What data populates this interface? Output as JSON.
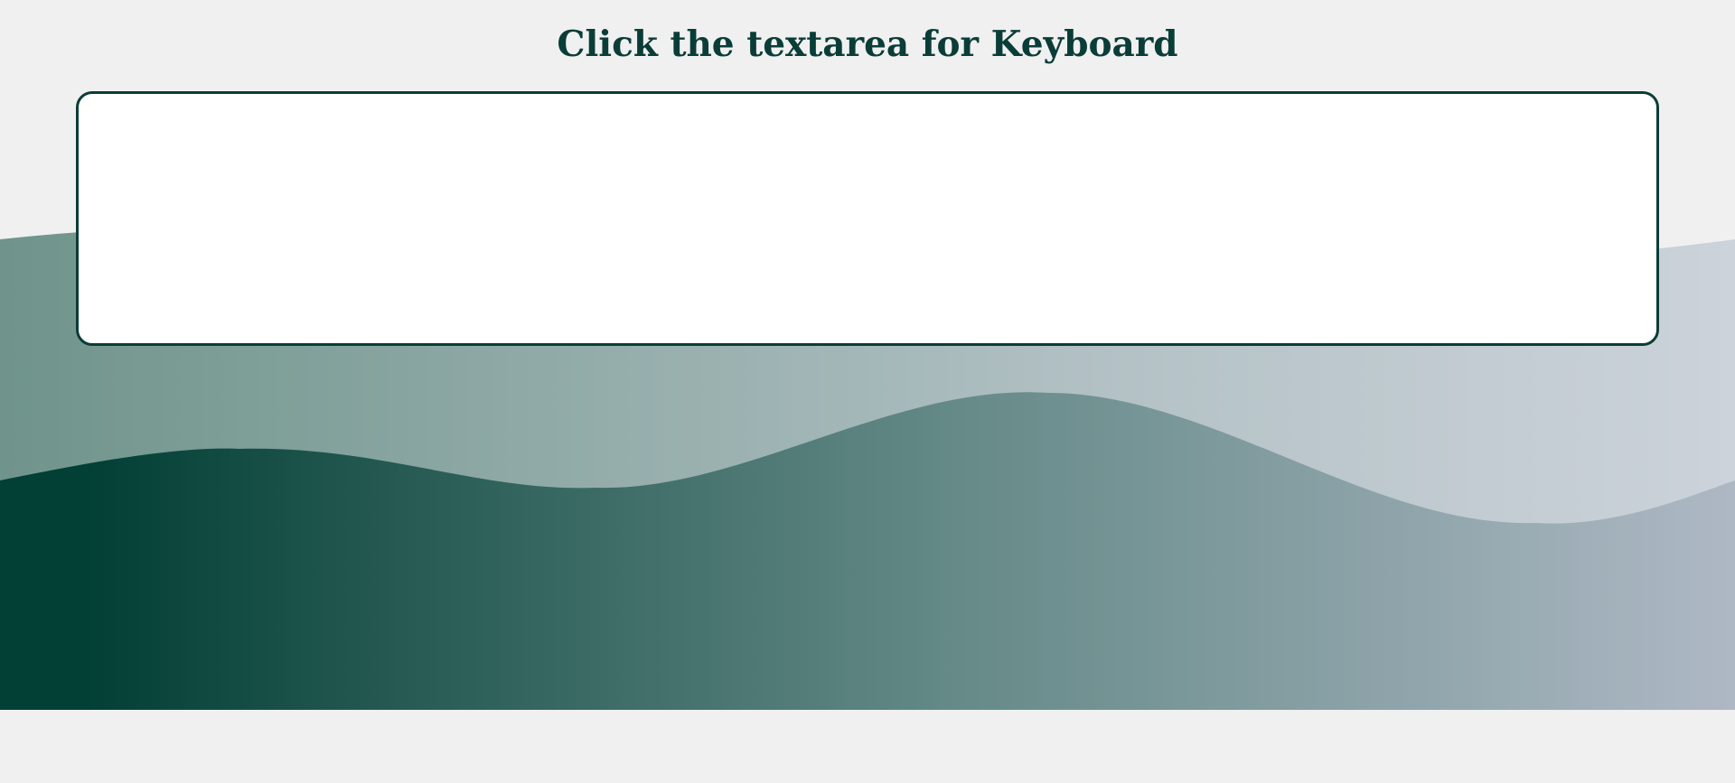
{
  "page": {
    "heading": "Click the textarea for Keyboard"
  },
  "input": {
    "value": "",
    "placeholder": ""
  },
  "colors": {
    "background": "#f0f0f0",
    "accent": "#0a3d37",
    "textarea_bg": "#ffffff",
    "wave_back_start": "#6f948b",
    "wave_back_end": "#ccd3da",
    "wave_front_start": "#023f35",
    "wave_front_end": "#aeb8c4"
  }
}
